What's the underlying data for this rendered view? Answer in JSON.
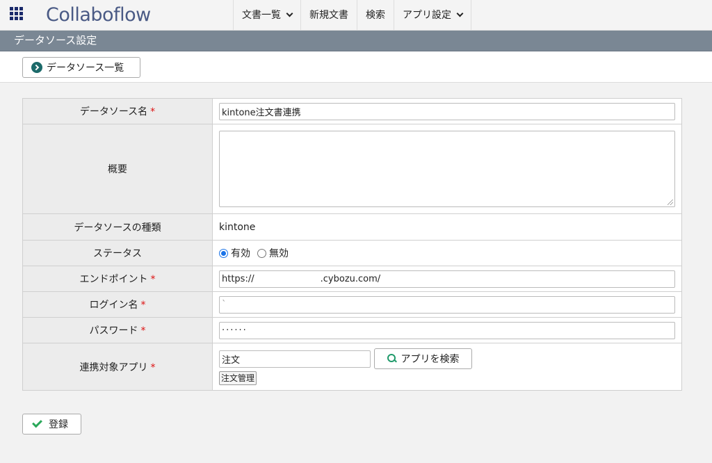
{
  "header": {
    "logo_text": "Collaboflow",
    "nav": [
      {
        "label": "文書一覧",
        "has_dropdown": true
      },
      {
        "label": "新規文書",
        "has_dropdown": false
      },
      {
        "label": "検索",
        "has_dropdown": false
      },
      {
        "label": "アプリ設定",
        "has_dropdown": true
      }
    ]
  },
  "page": {
    "title": "データソース設定",
    "back_button": "データソース一覧"
  },
  "form": {
    "datasource_name": {
      "label": "データソース名",
      "value": "kintone注文書連携",
      "required": true
    },
    "summary": {
      "label": "概要",
      "value": ""
    },
    "datasource_type": {
      "label": "データソースの種類",
      "value": "kintone"
    },
    "status": {
      "label": "ステータス",
      "options": [
        "有効",
        "無効"
      ],
      "selected": "有効"
    },
    "endpoint": {
      "label": "エンドポイント",
      "value": "https://                       .cybozu.com/",
      "required": true
    },
    "login_name": {
      "label": "ログイン名",
      "value": "`",
      "required": true
    },
    "password": {
      "label": "パスワード",
      "value": "······",
      "required": true
    },
    "linked_app": {
      "label": "連携対象アプリ",
      "value": "注文",
      "required": true,
      "search_button": "アプリを検索",
      "selected_app": "注文管理"
    }
  },
  "footer": {
    "register_button": "登録"
  },
  "required_mark": "*",
  "colors": {
    "title_bar": "#7a8794",
    "required": "#dd1111",
    "radio_accent": "#1a73e8",
    "check_icon": "#2aa85a",
    "back_icon": "#1c6a6a"
  }
}
